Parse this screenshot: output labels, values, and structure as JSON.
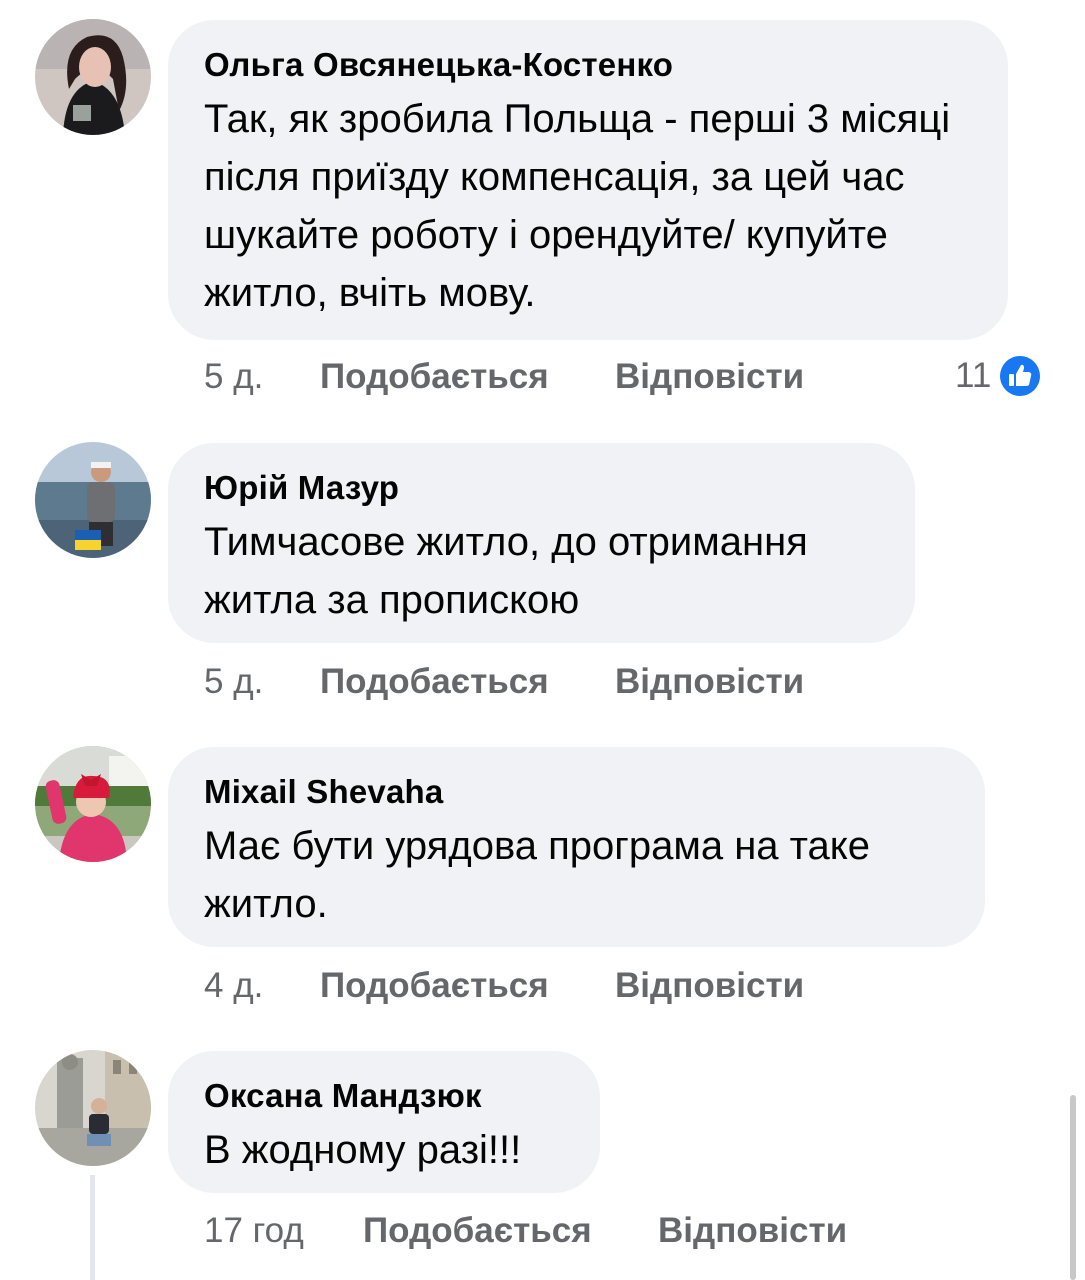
{
  "comments": [
    {
      "author": "Ольга Овсянецька-Костенко",
      "text": "Так, як зробила Польща - перші 3 місяці після приїзду компенсація, за цей час шукайте роботу і орендуйте/ купуйте житло, вчіть мову.",
      "time": "5 д.",
      "like_label": "Подобається",
      "reply_label": "Відповісти",
      "reaction_count": "11",
      "reaction_icon": "like-icon"
    },
    {
      "author": "Юрій Мазур",
      "text": "Тимчасове житло, до отримання житла за пропискою",
      "time": "5 д.",
      "like_label": "Подобається",
      "reply_label": "Відповісти"
    },
    {
      "author": "Mixail Shevaha",
      "text": "Має бути урядова програма на таке житло.",
      "time": "4 д.",
      "like_label": "Подобається",
      "reply_label": "Відповісти"
    },
    {
      "author": "Оксана Мандзюк",
      "text": "В жодному разі!!!",
      "time": "17 год",
      "like_label": "Подобається",
      "reply_label": "Відповісти"
    }
  ],
  "colors": {
    "bubble": "#f0f2f5",
    "text": "#050505",
    "secondary": "#65676b",
    "like_blue": "#1877f2"
  }
}
